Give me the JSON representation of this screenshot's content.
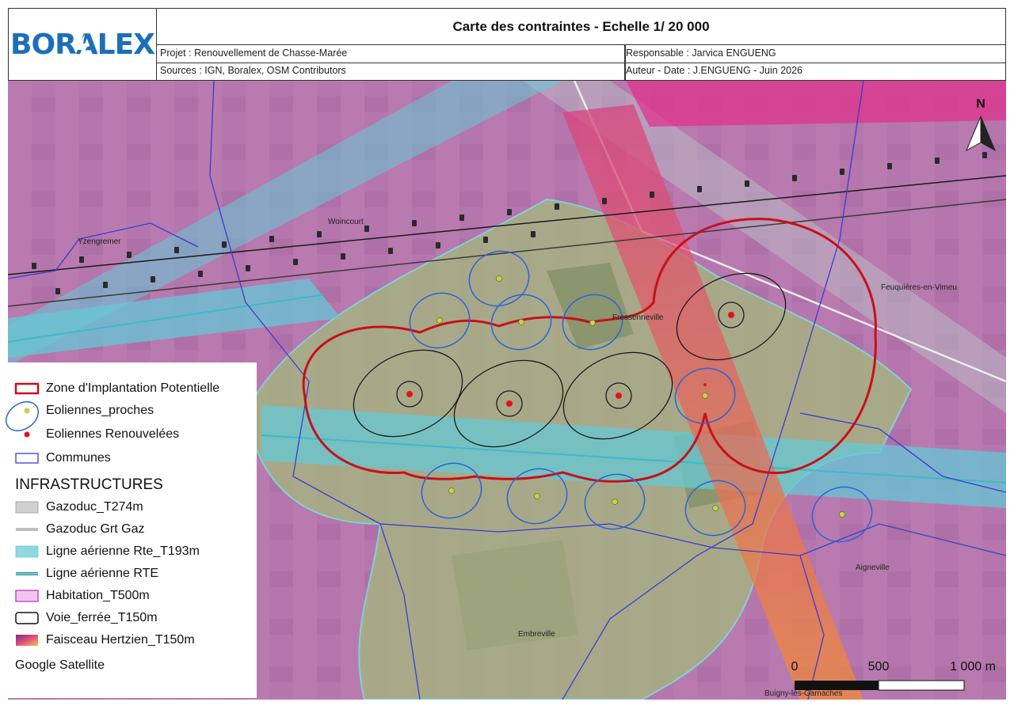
{
  "header": {
    "logo": "BORALEX",
    "title": "Carte des contraintes - Echelle 1/ 20 000",
    "projet": "Projet : Renouvellement de Chasse-Marée",
    "responsable": "Responsable : Jarvica ENGUENG",
    "sources": "Sources : IGN, Boralex, OSM Contributors",
    "auteur_date": "Auteur - Date : J.ENGUENG - Juin 2026"
  },
  "north_arrow": "N",
  "places": {
    "yzengremer": "Yzengremer",
    "woincourt": "Woincourt",
    "fressenneville": "Fressenneville",
    "feuquieres": "Feuquières-en-Vimeu",
    "aigneville": "Aigneville",
    "embreville": "Embreville",
    "buigny": "Buigny-lès-Gamaches"
  },
  "scale_bar": {
    "t0": "0",
    "t1": "500",
    "t2": "1 000 m"
  },
  "legend": {
    "zip": "Zone d'Implantation Potentielle",
    "eol_proches": "Eoliennes_proches",
    "eol_renouvelees": "Eoliennes Renouvelées",
    "communes": "Communes",
    "heading_infra": "INFRASTRUCTURES",
    "gazoduc_t274": "Gazoduc_T274m",
    "gazoduc_grt": "Gazoduc Grt Gaz",
    "ligne_rte_t193": "Ligne aérienne Rte_T193m",
    "ligne_rte": "Ligne aérienne RTE",
    "habitation": "Habitation_T500m",
    "voie_ferree": "Voie_ferrée_T150m",
    "faisceau": "Faisceau Hertzien_T150m",
    "basemap": "Google Satellite"
  },
  "colors": {
    "brand_blue": "#1d6fb8",
    "zip_red": "#c8101a",
    "habitation_magenta": "#c64fc6",
    "ligne_rte_cyan": "#6fd3dc",
    "faisceau_orange": "#f07a3a",
    "communes_blue": "#3b3bd0",
    "eol_proches_yellow": "#c8d24a",
    "eol_ren_red": "#e0141c"
  }
}
